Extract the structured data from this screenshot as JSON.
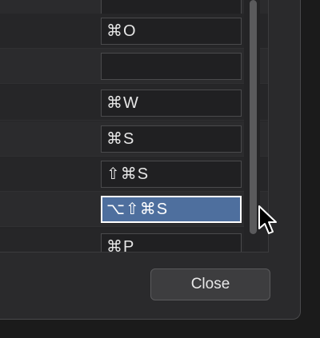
{
  "shortcuts": [
    {
      "key": "",
      "right": "",
      "selected": false
    },
    {
      "key": "⌘O",
      "right": "(",
      "selected": false
    },
    {
      "key": "",
      "right": "",
      "selected": false
    },
    {
      "key": "⌘W",
      "right": "(",
      "selected": false
    },
    {
      "key": "⌘S",
      "right": "(",
      "selected": false
    },
    {
      "key": "⇧⌘S",
      "right": "(",
      "selected": false
    },
    {
      "key": "⌥⇧⌘S",
      "right": "(",
      "selected": true
    },
    {
      "key": "⌘P",
      "right": "(",
      "selected": false
    }
  ],
  "buttons": {
    "close_label": "Close"
  },
  "colors": {
    "selection": "#4e6f9e",
    "background": "#2a2a2c"
  }
}
